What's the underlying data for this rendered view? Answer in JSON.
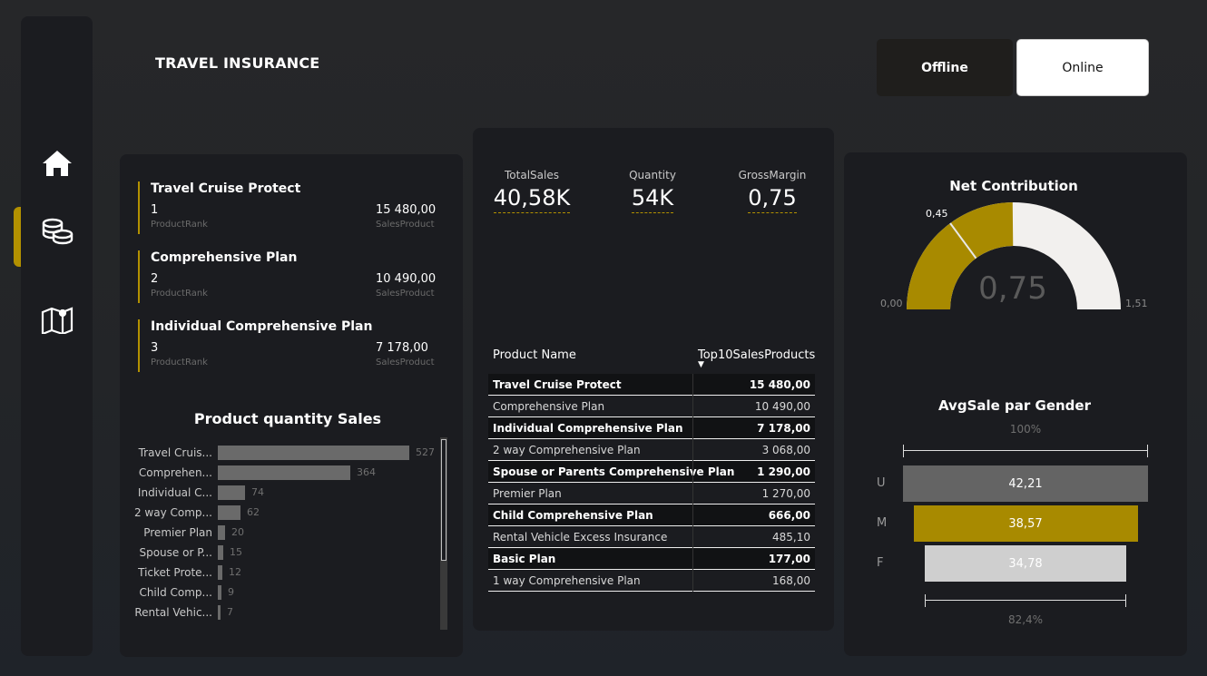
{
  "page": {
    "title": "TRAVEL INSURANCE",
    "toggle": {
      "offline": "Offline",
      "online": "Online",
      "selected": "Online"
    }
  },
  "sidebar": {
    "items": [
      {
        "icon": "home-icon"
      },
      {
        "icon": "coins-icon",
        "active": true
      },
      {
        "icon": "map-icon"
      }
    ]
  },
  "top_products": [
    {
      "name": "Travel Cruise Protect",
      "rank": "1",
      "rank_label": "ProductRank",
      "sales": "15 480,00",
      "sales_label": "SalesProduct"
    },
    {
      "name": "Comprehensive Plan",
      "rank": "2",
      "rank_label": "ProductRank",
      "sales": "10 490,00",
      "sales_label": "SalesProduct"
    },
    {
      "name": "Individual Comprehensive Plan",
      "rank": "3",
      "rank_label": "ProductRank",
      "sales": "7 178,00",
      "sales_label": "SalesProduct"
    }
  ],
  "quantity_chart": {
    "title": "Product quantity Sales",
    "items": [
      {
        "label": "Travel Cruis...",
        "value": 527
      },
      {
        "label": "Comprehen...",
        "value": 364
      },
      {
        "label": "Individual C...",
        "value": 74
      },
      {
        "label": "2 way Comp...",
        "value": 62
      },
      {
        "label": "Premier Plan",
        "value": 20
      },
      {
        "label": "Spouse or P...",
        "value": 15
      },
      {
        "label": "Ticket Prote...",
        "value": 12
      },
      {
        "label": "Child Comp...",
        "value": 9
      },
      {
        "label": "Rental Vehic...",
        "value": 7
      }
    ]
  },
  "kpis": [
    {
      "label": "TotalSales",
      "value": "40,58K"
    },
    {
      "label": "Quantity",
      "value": "54K"
    },
    {
      "label": "GrossMargin",
      "value": "0,75"
    }
  ],
  "table": {
    "headers": [
      "Product Name",
      "Top10SalesProducts"
    ],
    "sort_indicator": "▼",
    "rows": [
      [
        "Travel Cruise Protect",
        "15 480,00"
      ],
      [
        "Comprehensive Plan",
        "10 490,00"
      ],
      [
        "Individual Comprehensive Plan",
        "7 178,00"
      ],
      [
        "2 way Comprehensive Plan",
        "3 068,00"
      ],
      [
        "Spouse or Parents Comprehensive Plan",
        "1 290,00"
      ],
      [
        "Premier Plan",
        "1 270,00"
      ],
      [
        "Child Comprehensive Plan",
        "666,00"
      ],
      [
        "Rental Vehicle Excess Insurance",
        "485,10"
      ],
      [
        "Basic Plan",
        "177,00"
      ],
      [
        "1 way Comprehensive Plan",
        "168,00"
      ]
    ]
  },
  "gauge": {
    "title": "Net Contribution",
    "value": 0.75,
    "value_label": "0,75",
    "min": 0,
    "min_label": "0,00",
    "max": 1.51,
    "max_label": "1,51",
    "target": 0.45,
    "target_label": "0,45"
  },
  "funnel": {
    "title": "AvgSale par Gender",
    "top_label": "100%",
    "bottom_label": "82,4%",
    "items": [
      {
        "gender": "U",
        "value": 42.21,
        "label": "42,21",
        "color": "#646464",
        "text_color": "#ffffff"
      },
      {
        "gender": "M",
        "value": 38.57,
        "label": "38,57",
        "color": "#a88a00",
        "text_color": "#ffffff"
      },
      {
        "gender": "F",
        "value": 34.78,
        "label": "34,78",
        "color": "#cfcfcf",
        "text_color": "#ffffff"
      }
    ]
  },
  "colors": {
    "accent": "#b39100",
    "panel": "#1b1c20",
    "bar": "#6a6a6a"
  }
}
